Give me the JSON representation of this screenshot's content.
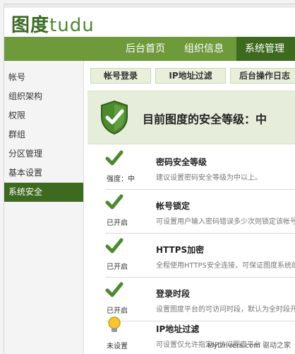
{
  "app": {
    "logo_cn": "图度",
    "logo_en": "tudu"
  },
  "nav": {
    "tabs": [
      {
        "label": "后台首页"
      },
      {
        "label": "组织信息"
      },
      {
        "label": "系统管理"
      }
    ]
  },
  "sidebar": {
    "items": [
      {
        "label": "帐号"
      },
      {
        "label": "组织架构"
      },
      {
        "label": "权限"
      },
      {
        "label": "群组"
      },
      {
        "label": "分区管理"
      },
      {
        "label": "基本设置"
      },
      {
        "label": "系统安全"
      }
    ]
  },
  "subtabs": [
    {
      "label": "帐号登录"
    },
    {
      "label": "IP地址过滤"
    },
    {
      "label": "后台操作日志"
    }
  ],
  "security": {
    "level_title": "目前图度的安全等级：中"
  },
  "rows": [
    {
      "icon": "check-icon",
      "status": "强度：中",
      "name": "密码安全等级",
      "desc": "建议设置密码安全等级为中以上。"
    },
    {
      "icon": "check-icon",
      "status": "已开启",
      "name": "帐号锁定",
      "desc": "可设置用户输入密码错误多少次则锁定该帐号"
    },
    {
      "icon": "check-icon",
      "status": "已开启",
      "name": "HTTPS加密",
      "desc": "全程使用HTTPS安全连接，可保证图度系统的"
    },
    {
      "icon": "check-icon",
      "status": "已开启",
      "name": "登录时段",
      "desc": "设置图度平台的可访问时段，默认为全时段开"
    },
    {
      "icon": "bulb-icon",
      "status": "未设置",
      "name": "IP地址过滤",
      "desc": "可设置仅允许指定IP访问图度平台"
    }
  ],
  "watermark": "MyDrivers.com 驱动之家",
  "colors": {
    "nav_bg": "#6f9a3c",
    "nav_active": "#3d6a1f",
    "hero_bg": "#e6eedb",
    "check_green": "#4d8a2f"
  }
}
